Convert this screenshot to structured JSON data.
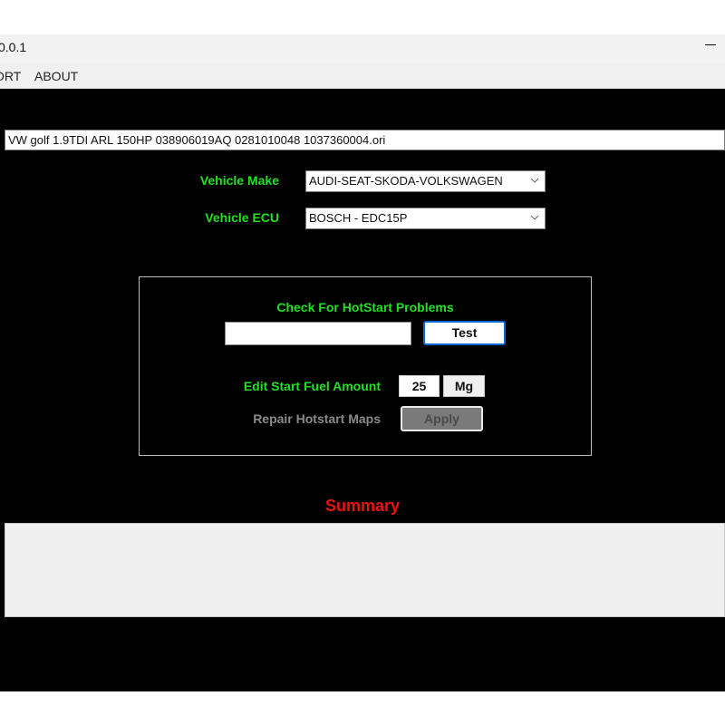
{
  "window": {
    "title": "0.0.1",
    "minimize_icon": "minimize-icon"
  },
  "menu": {
    "items": [
      {
        "label": "ORT"
      },
      {
        "label": "ABOUT"
      }
    ]
  },
  "file": {
    "path": "VW golf 1.9TDI ARL 150HP 038906019AQ 0281010048 1037360004.ori"
  },
  "vehicle": {
    "make_label": "Vehicle Make",
    "make_value": "AUDI-SEAT-SKODA-VOLKSWAGEN",
    "ecu_label": "Vehicle ECU",
    "ecu_value": "BOSCH - EDC15P",
    "dropdown_icon": "chevron-down-icon"
  },
  "hotstart": {
    "check_title": "Check For HotStart Problems",
    "test_input_value": "",
    "test_button": "Test",
    "fuel_label": "Edit Start Fuel Amount",
    "fuel_value": "25",
    "fuel_unit": "Mg",
    "repair_label": "Repair Hotstart Maps",
    "apply_button": "Apply"
  },
  "summary": {
    "title": "Summary",
    "content": ""
  },
  "colors": {
    "label_green": "#22e022",
    "summary_red": "#ee1111",
    "background": "#000000",
    "test_button_border": "#0b6bd6",
    "disabled_gray": "#8a8a8a"
  }
}
